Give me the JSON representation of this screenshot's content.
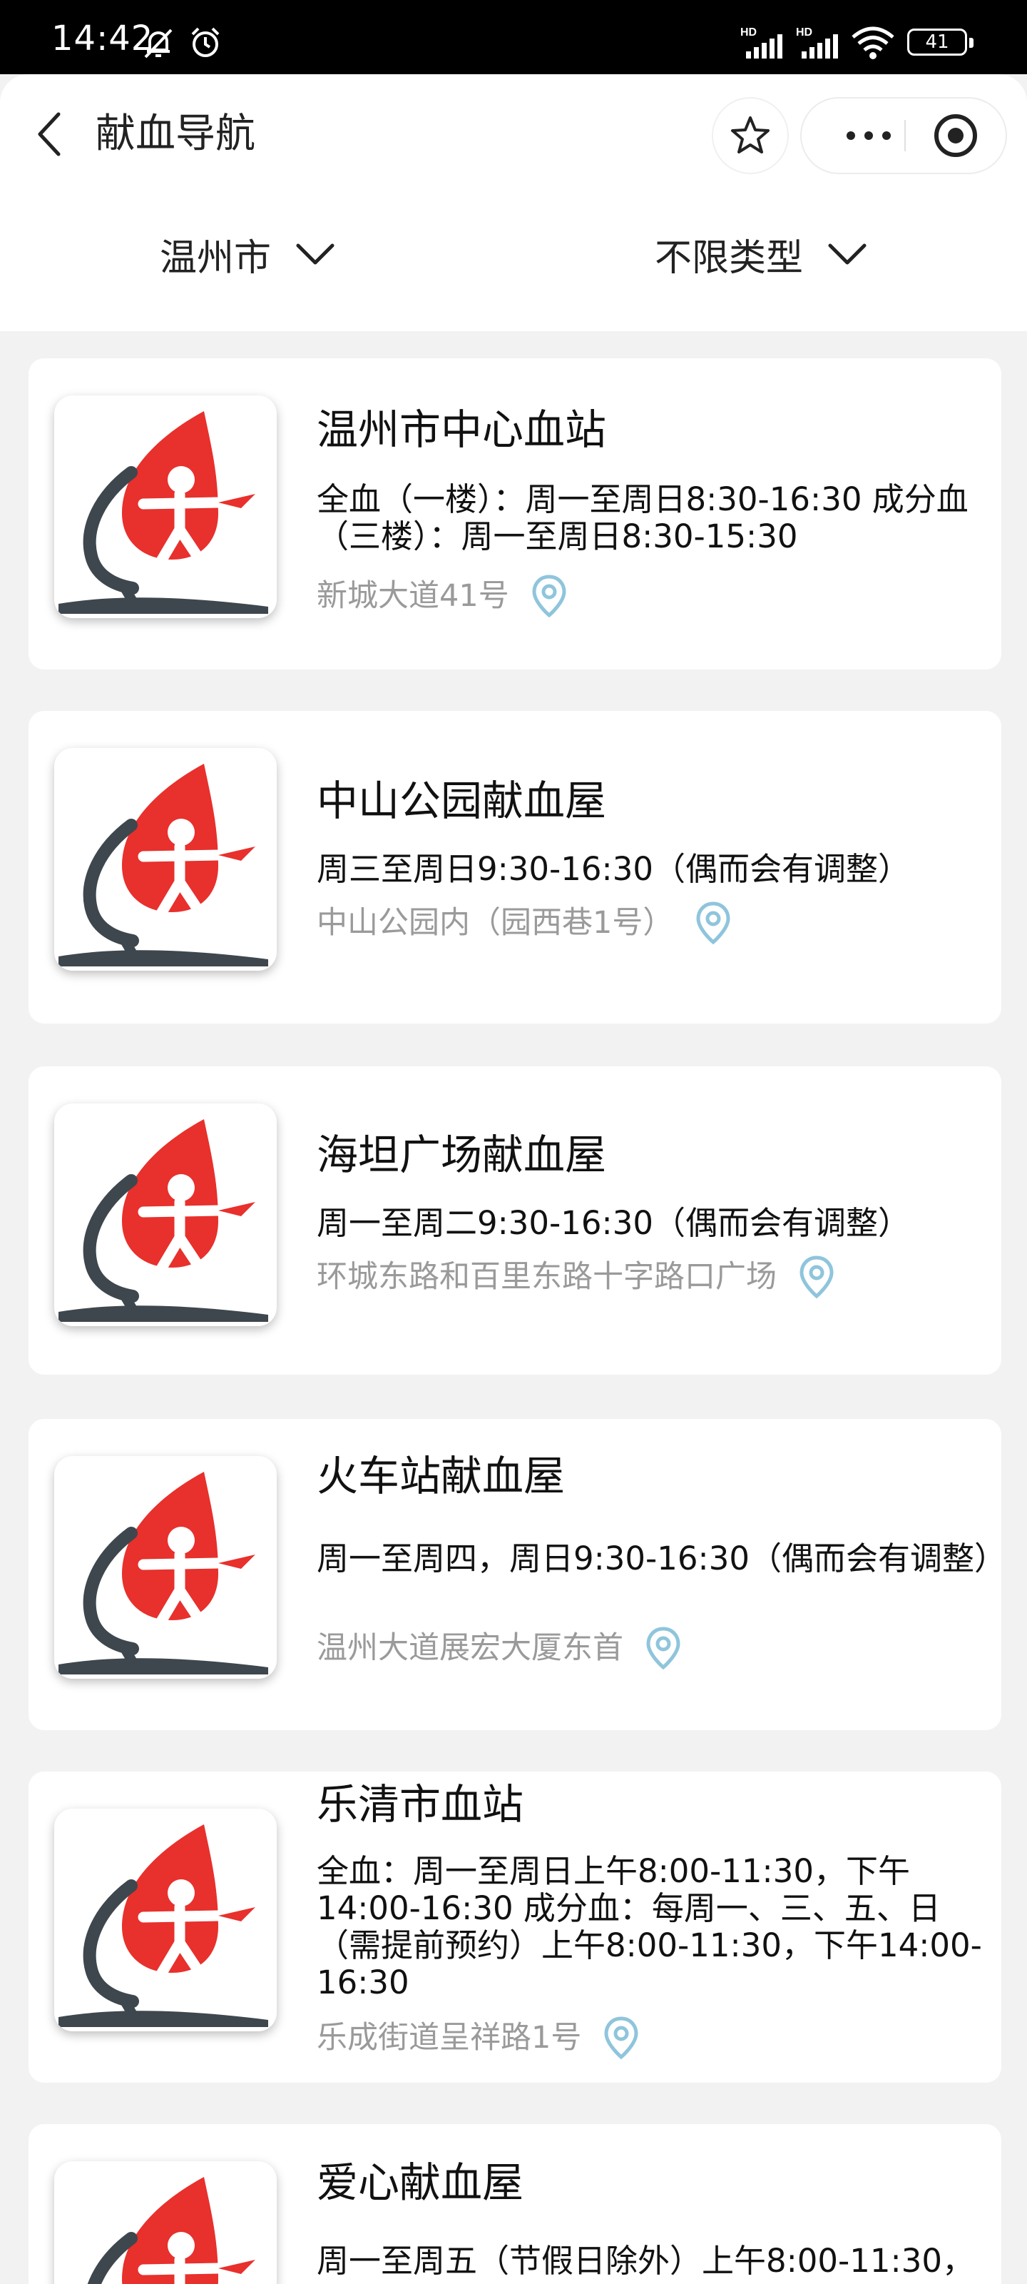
{
  "status_bar": {
    "time": "14:42",
    "battery": "41",
    "icons": [
      "bell-off-icon",
      "alarm-icon",
      "hd-signal-icon",
      "hd-signal-icon",
      "wifi-icon",
      "battery-icon"
    ]
  },
  "header": {
    "title": "献血导航",
    "back_icon": "chevron-left-icon",
    "favorite_icon": "star-icon",
    "more_icon": "more-dots-icon",
    "close_icon": "target-icon"
  },
  "filters": {
    "city": "温州市",
    "type": "不限类型",
    "chevron_icon": "chevron-down-icon"
  },
  "colors": {
    "logo_red": "#e8302c",
    "logo_dark": "#3e474d",
    "pin_blue": "#8fc5dc",
    "address_gray": "#9a9a9a"
  },
  "stations": [
    {
      "name": "温州市中心血站",
      "hours": "全血（一楼）：周一至周日8:30-16:30 成分血（三楼）：周一至周日8:30-15:30",
      "address": "新城大道41号"
    },
    {
      "name": "中山公园献血屋",
      "hours": "周三至周日9:30-16:30（偶而会有调整）",
      "address": "中山公园内（园西巷1号）"
    },
    {
      "name": "海坦广场献血屋",
      "hours": "周一至周二9:30-16:30（偶而会有调整）",
      "address": "环城东路和百里东路十字路口广场"
    },
    {
      "name": "火车站献血屋",
      "hours": "周一至周四，周日9:30-16:30（偶而会有调整）",
      "address": "温州大道展宏大厦东首"
    },
    {
      "name": "乐清市血站",
      "hours": "全血：周一至周日上午8:00-11:30，下午14:00-16:30 成分血：每周一、三、五、日（需提前预约）上午8:00-11:30，下午14:00-16:30",
      "address": "乐成街道呈祥路1号"
    },
    {
      "name": "爱心献血屋",
      "hours": "周一至周五（节假日除外）上午8:00-11:30，",
      "address": ""
    }
  ]
}
